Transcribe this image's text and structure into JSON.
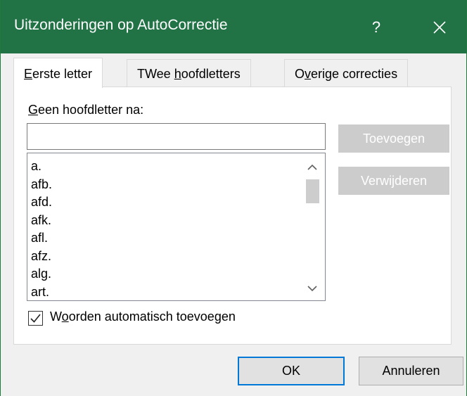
{
  "window": {
    "title": "Uitzonderingen op AutoCorrectie",
    "help_label": "?"
  },
  "tabs": [
    {
      "label_pre": "",
      "label_ul": "E",
      "label_post": "erste letter"
    },
    {
      "label_pre": "TWee ",
      "label_ul": "h",
      "label_post": "oofdletters"
    },
    {
      "label_pre": "O",
      "label_ul": "v",
      "label_post": "erige correcties"
    }
  ],
  "first_letter": {
    "field_label_ul": "G",
    "field_label_rest": "een hoofdletter na:",
    "input_value": "",
    "items": [
      "a.",
      "afb.",
      "afd.",
      "afk.",
      "afl.",
      "afz.",
      "alg.",
      "art."
    ],
    "add_label": "Toevoegen",
    "delete_label": "Verwijderen",
    "auto_add_checked": true,
    "auto_add_pre": "W",
    "auto_add_ul": "o",
    "auto_add_post": "orden automatisch toevoegen"
  },
  "footer": {
    "ok_label": "OK",
    "cancel_label": "Annuleren"
  },
  "colors": {
    "titlebar": "#217346",
    "disabled_button": "#cccccc",
    "default_button_border": "#0078d7"
  }
}
